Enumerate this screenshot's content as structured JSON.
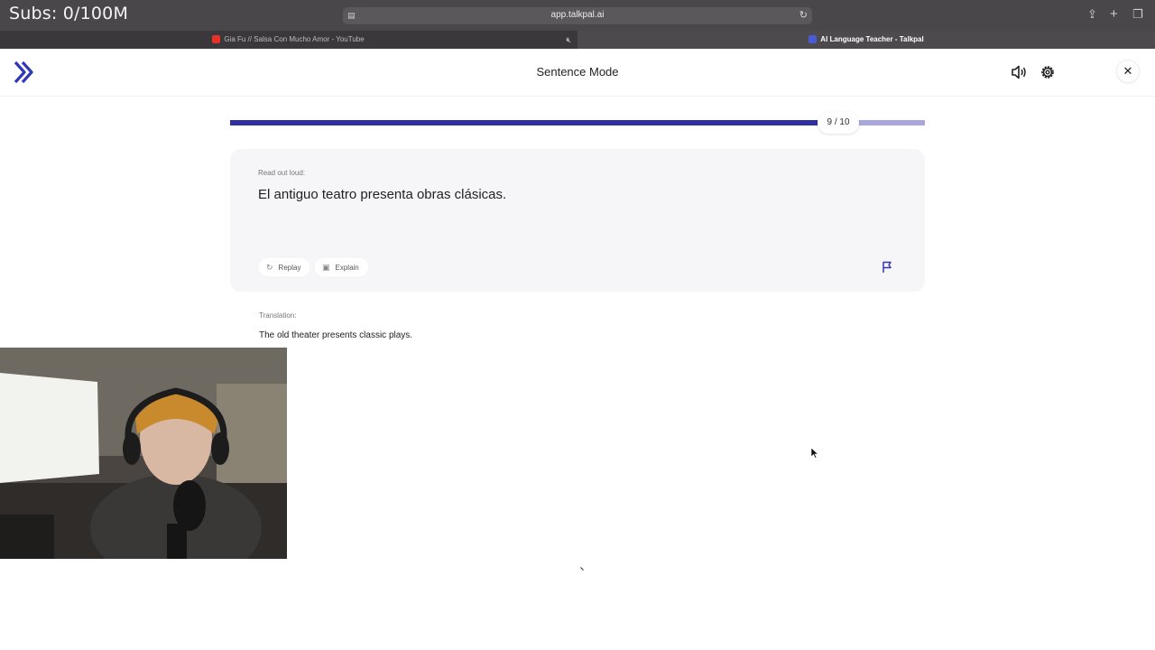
{
  "overlay": {
    "subs_text": "Subs: 0/100M"
  },
  "browser": {
    "url": "app.talkpal.ai",
    "tabs": [
      {
        "label": "Gia Fu // Salsa Con Mucho Amor - YouTube",
        "favicon_color": "#e5332a",
        "muted_icon": "speaker-muted-icon"
      },
      {
        "label": "AI Language Teacher - Talkpal",
        "favicon_color": "#4a5bd4"
      }
    ]
  },
  "header": {
    "title": "Sentence Mode",
    "brand_color": "#3238b5",
    "icons": [
      "talkpal-logo-icon",
      "speaker-icon",
      "gear-icon",
      "close-icon"
    ]
  },
  "progress": {
    "label": "9 / 10",
    "current": 9,
    "total": 10,
    "fill_fraction": 0.845
  },
  "card": {
    "hint": "Read out loud:",
    "sentence": "El antiguo teatro presenta obras clásicas.",
    "replay_label": "Replay",
    "explain_label": "Explain"
  },
  "translation": {
    "label": "Translation:",
    "text": "The old theater presents classic plays."
  }
}
